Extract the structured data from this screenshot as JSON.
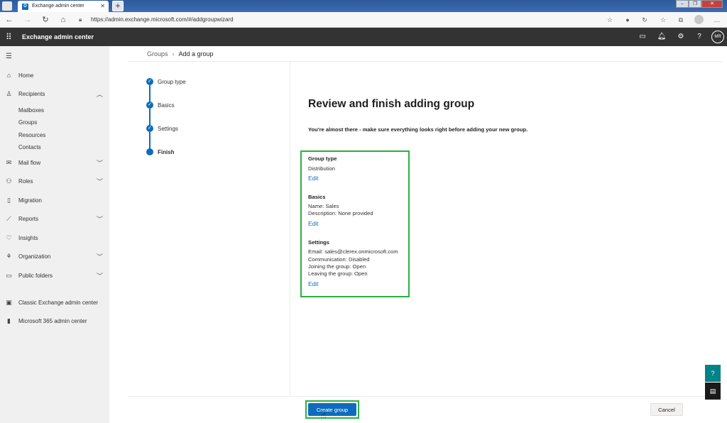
{
  "browser": {
    "tab_title": "Exchange admin center",
    "url": "https://admin.exchange.microsoft.com/#/addgroupwizard"
  },
  "app": {
    "title": "Exchange admin center",
    "avatar_initials": "MR"
  },
  "nav": {
    "items": [
      {
        "label": "Home",
        "icon": "home-icon"
      },
      {
        "label": "Recipients",
        "icon": "person-icon"
      },
      {
        "label": "Mail flow",
        "icon": "mail-icon"
      },
      {
        "label": "Roles",
        "icon": "roles-icon"
      },
      {
        "label": "Migration",
        "icon": "document-icon"
      },
      {
        "label": "Reports",
        "icon": "chart-icon"
      },
      {
        "label": "Insights",
        "icon": "lightbulb-icon"
      },
      {
        "label": "Organization",
        "icon": "org-icon"
      },
      {
        "label": "Public folders",
        "icon": "folder-icon"
      },
      {
        "label": "Classic Exchange admin center",
        "icon": "exchange-icon"
      },
      {
        "label": "Microsoft 365 admin center",
        "icon": "office-icon"
      }
    ],
    "recipients_sub": [
      "Mailboxes",
      "Groups",
      "Resources",
      "Contacts"
    ]
  },
  "breadcrumb": {
    "parent": "Groups",
    "current": "Add a group"
  },
  "steps": [
    {
      "label": "Group type",
      "state": "complete"
    },
    {
      "label": "Basics",
      "state": "complete"
    },
    {
      "label": "Settings",
      "state": "complete"
    },
    {
      "label": "Finish",
      "state": "current"
    }
  ],
  "review": {
    "title": "Review and finish adding group",
    "subtitle": "You're almost there - make sure everything looks right before adding your new group.",
    "group_type": {
      "heading": "Group type",
      "lines": [
        "Distribution"
      ],
      "edit": "Edit"
    },
    "basics": {
      "heading": "Basics",
      "lines": [
        "Name: Sales",
        "Description: None provided"
      ],
      "edit": "Edit"
    },
    "settings": {
      "heading": "Settings",
      "lines": [
        "Email: sales@clerex.onmicrosoft.com",
        "Communication: Disabled",
        "Joining the group: Open",
        "Leaving the group: Open"
      ],
      "edit": "Edit"
    }
  },
  "footer": {
    "primary": "Create group",
    "secondary": "Cancel"
  },
  "colors": {
    "accent": "#0f6cbd",
    "highlight": "#2bb043",
    "header_bg": "#333333"
  }
}
